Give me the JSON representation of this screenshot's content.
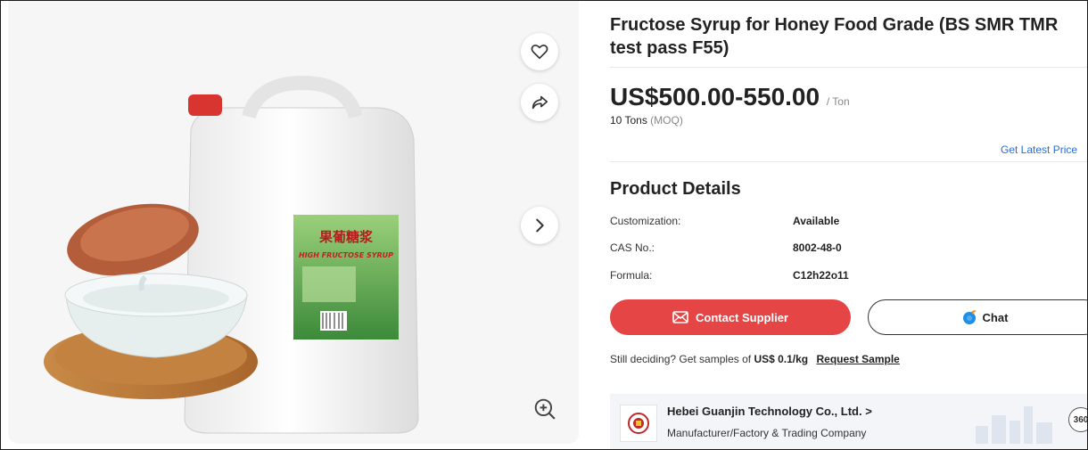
{
  "product": {
    "title": "Fructose Syrup for Honey Food Grade (BS SMR TMR test pass F55)",
    "price_range": "US$500.00-550.00",
    "price_unit": "/ Ton",
    "moq_value": "10 Tons",
    "moq_label": "(MOQ)",
    "latest_price_link": "Get Latest Price"
  },
  "image": {
    "label_cn": "果葡糖浆",
    "label_en": "HIGH FRUCTOSE SYRUP"
  },
  "details": {
    "title": "Product Details",
    "rows": [
      {
        "key": "Customization:",
        "value": "Available"
      },
      {
        "key": "CAS No.:",
        "value": "8002-48-0"
      },
      {
        "key": "Formula:",
        "value": "C12h22o11"
      }
    ]
  },
  "actions": {
    "contact_label": "Contact Supplier",
    "chat_label": "Chat"
  },
  "sample": {
    "prefix": "Still deciding? Get samples of",
    "price": "US$ 0.1/kg",
    "link": "Request Sample"
  },
  "supplier": {
    "name": "Hebei Guanjin Technology Co., Ltd. >",
    "type": "Manufacturer/Factory & Trading Company",
    "badge": "360"
  },
  "icons": {
    "favorite": "heart-icon",
    "share": "share-icon",
    "next": "chevron-right-icon",
    "zoom": "zoom-in-icon",
    "mail": "mail-icon",
    "chat": "chat-icon"
  },
  "colors": {
    "accent_red": "#e64545",
    "link_blue": "#2f6bd8",
    "chat_blue": "#1e8fe6"
  }
}
